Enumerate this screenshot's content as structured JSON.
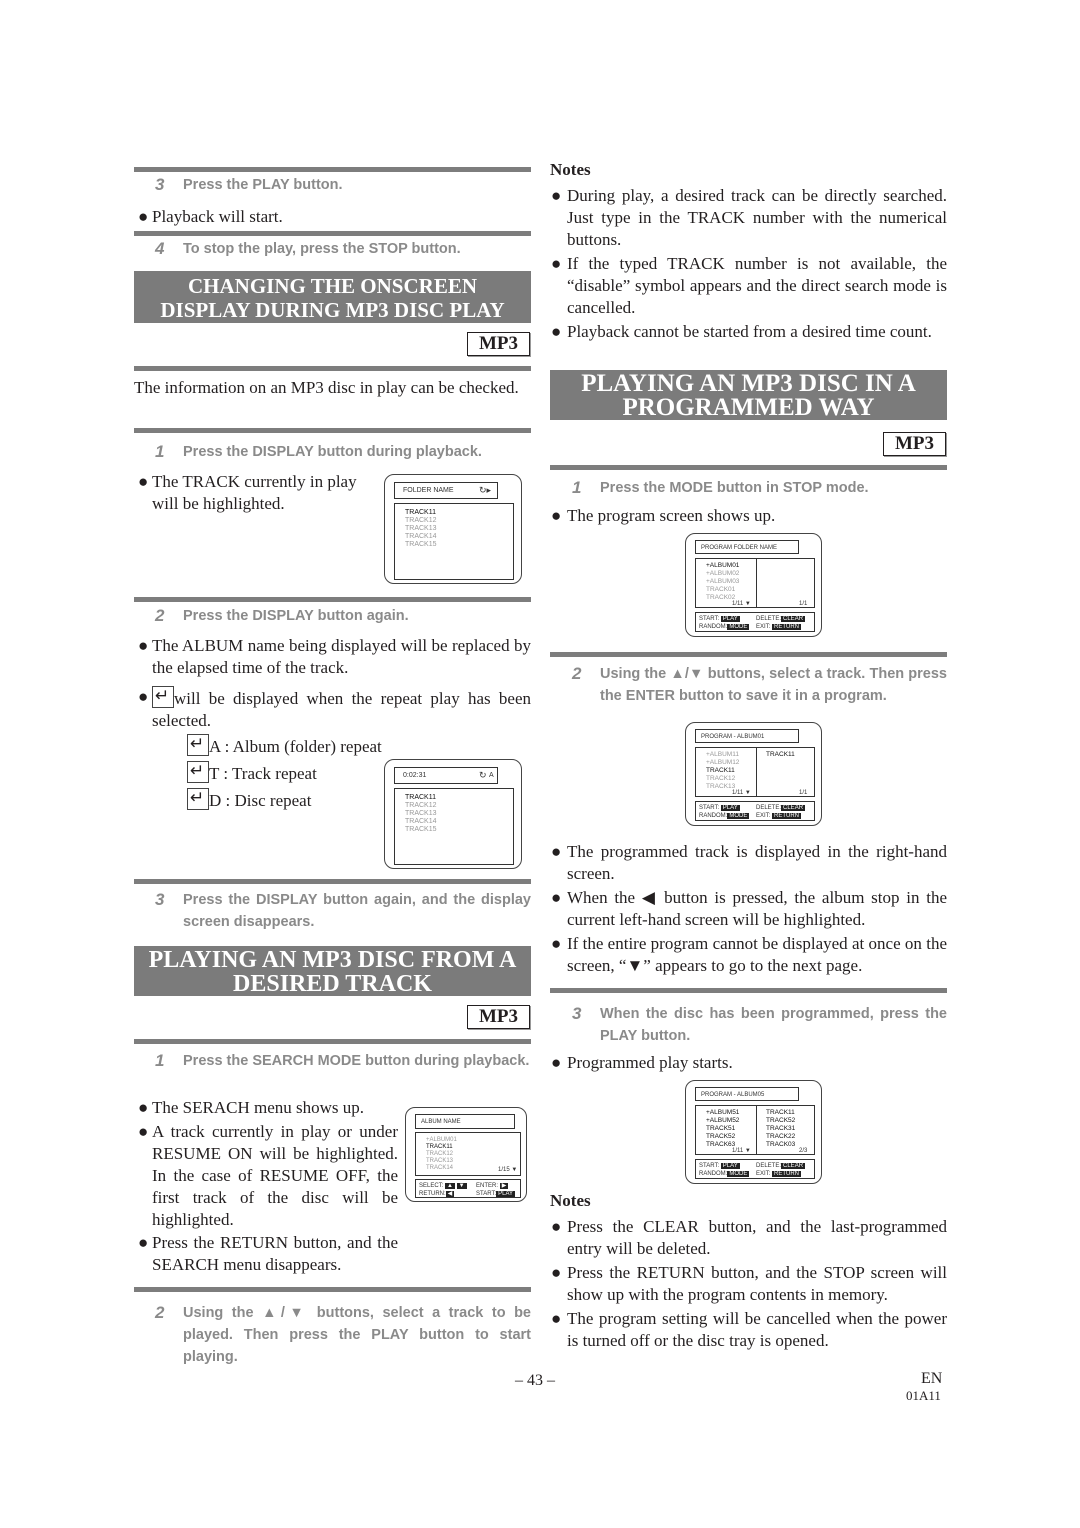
{
  "left": {
    "step3": {
      "num": "3",
      "text": "Press the PLAY button."
    },
    "step3_bullet": "Playback will start.",
    "step4": {
      "num": "4",
      "text": "To stop the play, press the STOP button."
    },
    "section1": {
      "title_line1": "CHANGING THE ONSCREEN",
      "title_line2": "DISPLAY DURING MP3 DISC PLAY",
      "badge": "MP3",
      "intro": "The information on an MP3 disc in play can be checked.",
      "step1": {
        "num": "1",
        "text": "Press the DISPLAY button during playback."
      },
      "step1_bullet": "The TRACK currently in play will be highlighted.",
      "screen1": {
        "header": "FOLDER NAME",
        "header_icons": "repeat-icon play-icon",
        "tracks": [
          {
            "name": "TRACK11",
            "highlighted": true
          },
          {
            "name": "TRACK12",
            "highlighted": false
          },
          {
            "name": "TRACK13",
            "highlighted": false
          },
          {
            "name": "TRACK14",
            "highlighted": false
          },
          {
            "name": "TRACK15",
            "highlighted": false
          }
        ]
      },
      "step2": {
        "num": "2",
        "text": "Press the DISPLAY button again."
      },
      "step2_bullet1": "The ALBUM name being displayed will be replaced by the elapsed time of the track.",
      "step2_bullet2": "will be displayed when the repeat play has been selected.",
      "repeat_modes": [
        {
          "code": "A",
          "label": "A : Album (folder) repeat"
        },
        {
          "code": "T",
          "label": "T : Track repeat"
        },
        {
          "code": "D",
          "label": "D : Disc repeat"
        }
      ],
      "screen2": {
        "header": "0:02:31",
        "header_right": "A",
        "tracks": [
          {
            "name": "TRACK11",
            "highlighted": true
          },
          {
            "name": "TRACK12",
            "highlighted": false
          },
          {
            "name": "TRACK13",
            "highlighted": false
          },
          {
            "name": "TRACK14",
            "highlighted": false
          },
          {
            "name": "TRACK15",
            "highlighted": false
          }
        ]
      },
      "step3": {
        "num": "3",
        "text": "Press the DISPLAY button again, and the display screen disappears."
      }
    },
    "section2": {
      "title_line1": "PLAYING AN MP3 DISC FROM A",
      "title_line2": "DESIRED TRACK",
      "badge": "MP3",
      "step1": {
        "num": "1",
        "text": "Press the SEARCH MODE button during playback."
      },
      "bullets": [
        "The SERACH menu shows up.",
        "A track currently in play or under RESUME ON will be highlighted. In the case of RESUME OFF, the first track of the disc will be highlighted.",
        "Press the RETURN button, and the SEARCH menu disappears."
      ],
      "screen": {
        "header": "ALBUM NAME",
        "items": [
          {
            "name": "+ALBUM01",
            "highlighted": false
          },
          {
            "name": "TRACK11",
            "highlighted": true
          },
          {
            "name": "TRACK12",
            "highlighted": false
          },
          {
            "name": "TRACK13",
            "highlighted": false
          },
          {
            "name": "TRACK14",
            "highlighted": false
          }
        ],
        "page": "1/15",
        "select_label": "SELECT:",
        "enter_label": "ENTER:",
        "return_label": "RETURN:",
        "start_label": "START:",
        "start_key": "PLAY"
      },
      "step2": {
        "num": "2",
        "text": "Using the ▲/▼ buttons, select a track to be played. Then press the PLAY button to start playing."
      }
    }
  },
  "right": {
    "notes1": {
      "heading": "Notes",
      "items": [
        "During play, a desired track can be directly searched. Just type in the TRACK number with the numerical buttons.",
        "If the typed TRACK number is not available, the “disable” symbol appears and the direct search mode is cancelled.",
        "Playback cannot be started from a desired time count."
      ]
    },
    "section3": {
      "title_line1": "PLAYING AN MP3 DISC IN A",
      "title_line2": "PROGRAMMED WAY",
      "badge": "MP3",
      "step1": {
        "num": "1",
        "text": "Press the MODE button in STOP mode."
      },
      "step1_bullet": "The program screen shows up.",
      "screen1": {
        "header": "PROGRAM FOLDER NAME",
        "left_items": [
          {
            "name": "+ALBUM01",
            "highlighted": true
          },
          {
            "name": "+ALBUM02",
            "highlighted": false
          },
          {
            "name": "+ALBUM03",
            "highlighted": false
          },
          {
            "name": "TRACK01",
            "highlighted": false
          },
          {
            "name": "TRACK02",
            "highlighted": false
          }
        ],
        "left_page": "1/11",
        "right_items": [],
        "right_page": "1/1",
        "keys": {
          "start": "START:",
          "start_key": "PLAY",
          "delete": "DELETE:",
          "delete_key": "CLEAR",
          "random": "RANDOM:",
          "random_key": "MODE",
          "exit": "EXIT:",
          "exit_key": "RETURN"
        }
      },
      "step2": {
        "num": "2",
        "text": "Using the ▲/▼ buttons, select a track. Then press the ENTER button to save it in a program."
      },
      "screen2": {
        "header": "PROGRAM - ALBUM01",
        "left_items": [
          {
            "name": "+ALBUM11",
            "highlighted": false
          },
          {
            "name": "+ALBUM12",
            "highlighted": false
          },
          {
            "name": "TRACK11",
            "highlighted": true
          },
          {
            "name": "TRACK12",
            "highlighted": false
          },
          {
            "name": "TRACK13",
            "highlighted": false
          }
        ],
        "left_page": "1/11",
        "right_items": [
          "TRACK11"
        ],
        "right_page": "1/1",
        "keys": {
          "start": "START:",
          "start_key": "PLAY",
          "delete": "DELETE:",
          "delete_key": "CLEAR",
          "random": "RANDOM:",
          "random_key": "MODE",
          "exit": "EXIT:",
          "exit_key": "RETURN"
        }
      },
      "step2_bullets": [
        "The programmed track is displayed in the right-hand screen.",
        "When the ◀ button is pressed, the album stop in the current left-hand screen will be highlighted.",
        "If the entire program cannot be displayed at once on the screen, “▼” appears to go to the next page."
      ],
      "step3": {
        "num": "3",
        "text": "When the disc has been programmed, press the PLAY button."
      },
      "step3_bullet": "Programmed play starts.",
      "screen3": {
        "header": "PROGRAM - ALBUM05",
        "left_items": [
          {
            "name": "+ALBUM51",
            "highlighted": true
          },
          {
            "name": "+ALBUM52",
            "highlighted": true
          },
          {
            "name": "TRACK51",
            "highlighted": true
          },
          {
            "name": "TRACK52",
            "highlighted": true
          },
          {
            "name": "TRACK63",
            "highlighted": true
          }
        ],
        "left_page": "1/11",
        "right_items": [
          "TRACK11",
          "TRACK52",
          "TRACK31",
          "TRACK22",
          "TRACK03"
        ],
        "right_page": "2/3",
        "keys": {
          "start": "START:",
          "start_key": "PLAY",
          "delete": "DELETE:",
          "delete_key": "CLEAR",
          "random": "RANDOM:",
          "random_key": "MODE",
          "exit": "EXIT:",
          "exit_key": "RETURN"
        }
      }
    },
    "notes2": {
      "heading": "Notes",
      "items": [
        "Press the CLEAR button, and the last-programmed entry will be deleted.",
        "Press the RETURN button, and the STOP screen will show up with the program contents in memory.",
        "The program setting will be cancelled when the power is turned off or the disc tray is opened."
      ]
    }
  },
  "footer": {
    "page_number": "– 43 –",
    "lang": "EN",
    "code": "01A11"
  },
  "colors": {
    "banner": "#7b7b7b",
    "rule": "#7d7d7d",
    "step_text": "#8a8a8a"
  }
}
